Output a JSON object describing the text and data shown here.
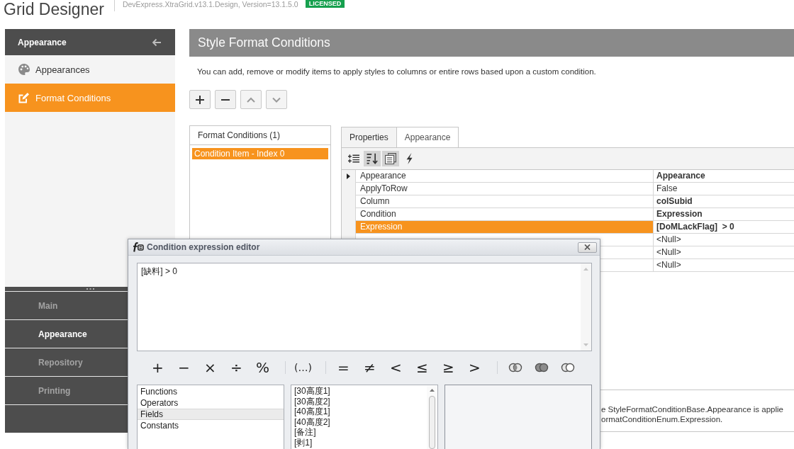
{
  "header": {
    "title": "Grid Designer",
    "assembly": "DevExpress.XtraGrid.v13.1.Design, Version=13.1.5.0",
    "badge": "LICENSED"
  },
  "sidebar": {
    "title": "Appearance",
    "items": [
      {
        "label": "Appearances",
        "kind": "palette",
        "selected": false
      },
      {
        "label": "Format Conditions",
        "kind": "edit",
        "selected": true
      }
    ],
    "groups": [
      {
        "label": "Main",
        "selected": false
      },
      {
        "label": "Appearance",
        "selected": true
      },
      {
        "label": "Repository",
        "selected": false
      },
      {
        "label": "Printing",
        "selected": false
      }
    ]
  },
  "page": {
    "title": "Style Format Conditions",
    "description": "You can add, remove or modify items to apply styles to columns or entire rows based upon a custom condition.",
    "toolbar": [
      {
        "kind": "add",
        "disabled": false
      },
      {
        "kind": "remove",
        "disabled": false
      },
      {
        "kind": "move_up",
        "disabled": true
      },
      {
        "kind": "move_down",
        "disabled": true
      }
    ]
  },
  "conditions_list": {
    "title": "Format Conditions (1)",
    "items": [
      {
        "label": "Condition Item - Index 0",
        "selected": true
      }
    ]
  },
  "property_grid": {
    "tabs": [
      {
        "label": "Properties",
        "selected": true
      },
      {
        "label": "Appearance",
        "selected": false
      }
    ],
    "toolbar": [
      {
        "kind": "categorized",
        "selected": false
      },
      {
        "kind": "alphabetical",
        "selected": true
      },
      {
        "kind": "property_pages",
        "selected": true
      },
      {
        "kind": "events",
        "selected": false
      }
    ],
    "rows": [
      {
        "name": "Appearance",
        "value": "Appearance",
        "modified": true,
        "expandable": true,
        "selected": false
      },
      {
        "name": "ApplyToRow",
        "value": "False",
        "modified": false,
        "expandable": false,
        "selected": false
      },
      {
        "name": "Column",
        "value": "colSubid",
        "modified": true,
        "expandable": false,
        "selected": false
      },
      {
        "name": "Condition",
        "value": "Expression",
        "modified": true,
        "expandable": false,
        "selected": false
      },
      {
        "name": "Expression",
        "value": "[DoMLackFlag]  > 0",
        "modified": true,
        "expandable": false,
        "selected": true
      },
      {
        "value": "<Null>",
        "modified": false,
        "selected": false
      },
      {
        "value": "<Null>",
        "modified": false,
        "selected": false
      },
      {
        "value": "<Null>",
        "modified": false,
        "selected": false
      }
    ],
    "help_lines": [
      "e StyleFormatConditionBase.Appearance is applie",
      "ormatConditionEnum.Expression."
    ]
  },
  "dialog": {
    "title": "Condition expression editor",
    "expression": "[缺料] > 0",
    "operator_groups": [
      [
        "+",
        "−",
        "×",
        "÷",
        "%"
      ],
      [
        "(…)"
      ],
      [
        "=",
        "≠",
        "<",
        "≤",
        "≥",
        ">"
      ]
    ],
    "logic_operators": [
      {
        "kind": "and"
      },
      {
        "kind": "or"
      },
      {
        "kind": "not"
      }
    ],
    "categories": [
      {
        "label": "Functions",
        "selected": false
      },
      {
        "label": "Operators",
        "selected": false
      },
      {
        "label": "Fields",
        "selected": true
      },
      {
        "label": "Constants",
        "selected": false
      }
    ],
    "fields": [
      {
        "label": "[30高度1]",
        "selected": false
      },
      {
        "label": "[30高度2]",
        "selected": false
      },
      {
        "label": "[40高度1]",
        "selected": false
      },
      {
        "label": "[40高度2]",
        "selected": false
      },
      {
        "label": "[备注]",
        "selected": false
      },
      {
        "label": "[剥1]",
        "selected": false
      }
    ]
  }
}
